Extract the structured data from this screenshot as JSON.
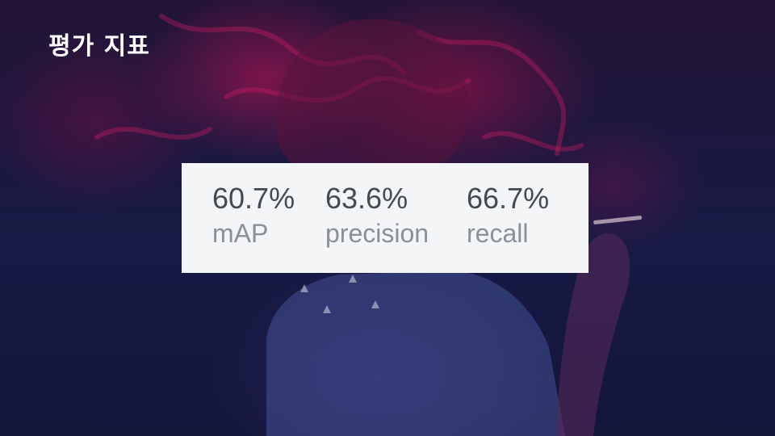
{
  "slide": {
    "title": "평가 지표"
  },
  "metrics": [
    {
      "value": "60.7%",
      "label": "mAP"
    },
    {
      "value": "63.6%",
      "label": "precision"
    },
    {
      "value": "66.7%",
      "label": "recall"
    }
  ],
  "colors": {
    "background_dark": "#171a45",
    "smoke_accent": "#c8145a",
    "card_background": "#f4f5f7",
    "value_text": "#444a54",
    "label_text": "#8a8f99",
    "title_text": "#ffffff"
  }
}
